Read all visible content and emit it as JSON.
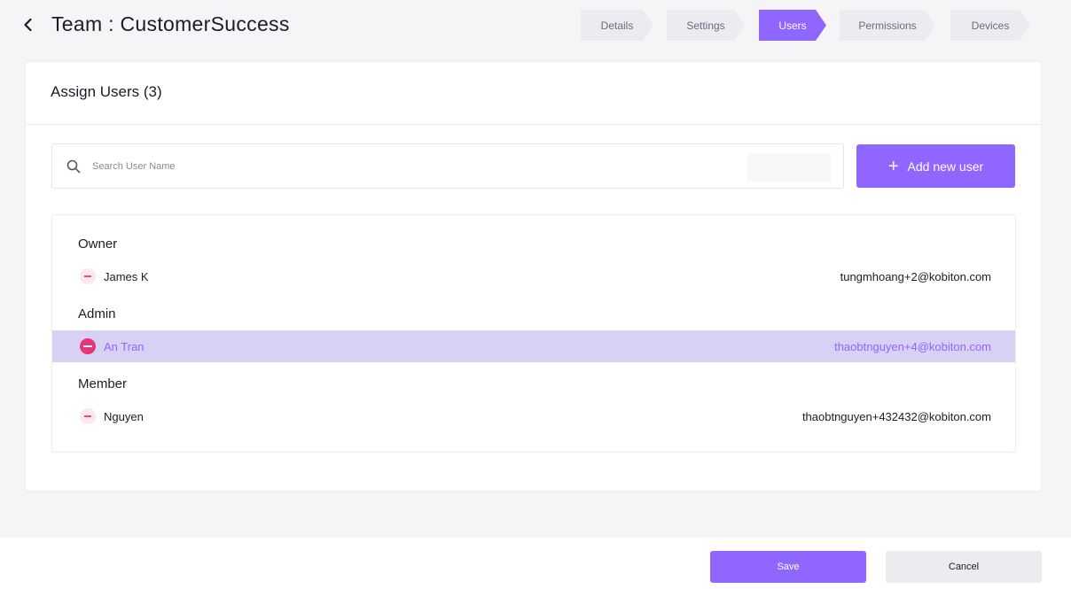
{
  "header": {
    "title": "Team : CustomerSuccess"
  },
  "steps": [
    {
      "label": "Details",
      "active": false
    },
    {
      "label": "Settings",
      "active": false
    },
    {
      "label": "Users",
      "active": true
    },
    {
      "label": "Permissions",
      "active": false
    },
    {
      "label": "Devices",
      "active": false
    }
  ],
  "assign": {
    "title": "Assign Users (3)",
    "search_placeholder": "Search User Name",
    "add_button": "Add new user"
  },
  "groups": [
    {
      "label": "Owner",
      "users": [
        {
          "name": "James K",
          "email": "tungmhoang+2@kobiton.com",
          "highlighted": false
        }
      ]
    },
    {
      "label": "Admin",
      "users": [
        {
          "name": "An Tran",
          "email": "thaobtnguyen+4@kobiton.com",
          "highlighted": true
        }
      ]
    },
    {
      "label": "Member",
      "users": [
        {
          "name": "Nguyen",
          "email": "thaobtnguyen+432432@kobiton.com",
          "highlighted": false
        }
      ]
    }
  ],
  "footer": {
    "save": "Save",
    "cancel": "Cancel"
  },
  "colors": {
    "accent": "#8f66ff",
    "remove": "#e8347a",
    "highlight_row": "#d8d1f6"
  }
}
